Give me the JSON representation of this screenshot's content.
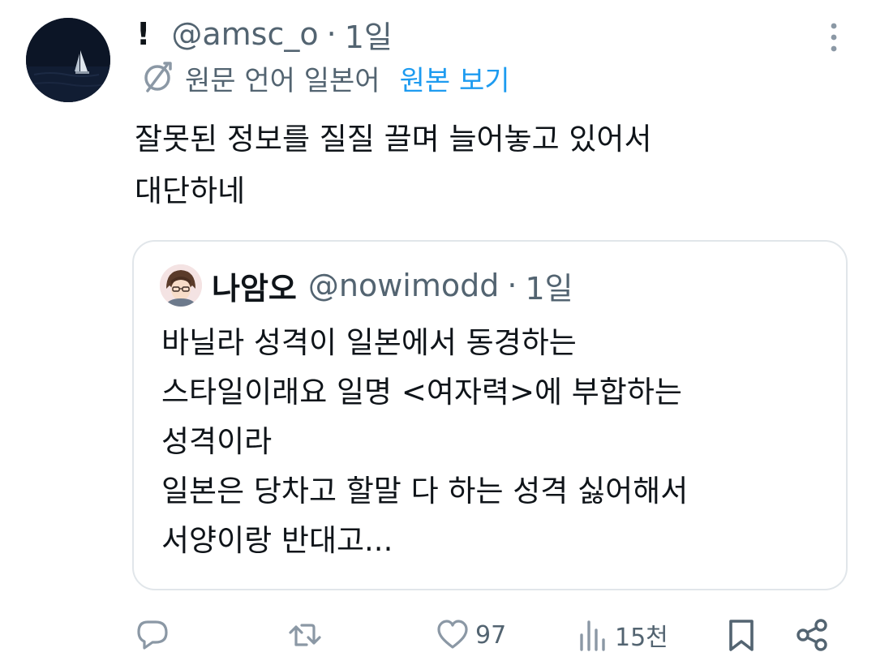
{
  "tweet": {
    "display_name": "!",
    "handle": "@amsc_o",
    "separator": "·",
    "time": "1일",
    "translation_note": "원문 언어 일본어",
    "show_original_label": "원본 보기",
    "text_lines": [
      "잘못된 정보를 질질 끌며 늘어놓고 있어서",
      "대단하네"
    ]
  },
  "quote": {
    "display_name": "나암오",
    "handle": "@nowimodd",
    "separator": "·",
    "time": "1일",
    "text_lines": [
      "바닐라 성격이 일본에서 동경하는",
      "스타일이래요 일명 <여자력>에 부합하는",
      "성격이라",
      "일본은 당차고 할말 다 하는 성격 싫어해서",
      "서양이랑 반대고..."
    ]
  },
  "actions": {
    "reply": {
      "icon": "reply-icon",
      "count": ""
    },
    "repost": {
      "icon": "repost-icon",
      "count": ""
    },
    "like": {
      "icon": "heart-icon",
      "count": "97"
    },
    "views": {
      "icon": "views-icon",
      "count": "15천"
    },
    "bookmark": {
      "icon": "bookmark-icon"
    },
    "share": {
      "icon": "share-icon"
    }
  },
  "colors": {
    "text_primary": "#0f1419",
    "text_secondary": "#536471",
    "accent": "#1d9bf0",
    "border": "#e1e6ea"
  }
}
